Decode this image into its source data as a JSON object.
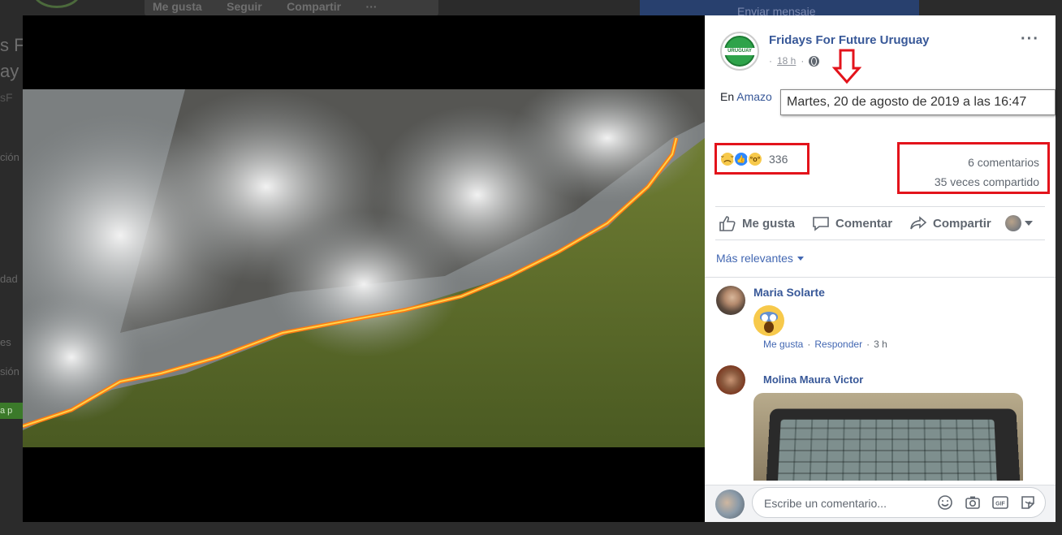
{
  "background": {
    "topbar": [
      "Me gusta",
      "Seguir",
      "Compartir",
      "···"
    ],
    "message_button": "Enviar mensaje",
    "side_title_lines": [
      "s F",
      "ay",
      "sF"
    ],
    "side_labels": [
      "ción",
      "dad",
      "es",
      "sión"
    ],
    "green_tag": "a p"
  },
  "post": {
    "page_name": "Fridays For Future Uruguay",
    "avatar_text": "URUGUAY",
    "time": "18 h",
    "separator": "·",
    "more": "···",
    "text_prefix": "En ",
    "text_link": "Amazo",
    "tooltip": "Martes, 20 de agosto de 2019 a las 16:47",
    "reactions": {
      "count": "336",
      "emojis": [
        "sad-emoji",
        "like-emoji",
        "wow-emoji"
      ],
      "faces": [
        "˘︵˘",
        "👍",
        "°o°"
      ]
    },
    "comments_count": "6 comentarios",
    "shares_count": "35 veces compartido",
    "actions": [
      "Me gusta",
      "Comentar",
      "Compartir"
    ],
    "sort_label": "Más relevantes"
  },
  "comments": [
    {
      "name": "Maria Solarte",
      "actions": [
        "Me gusta",
        "·",
        "Responder",
        "·",
        "3 h"
      ]
    },
    {
      "name": "Molina Maura Victor"
    }
  ],
  "composer": {
    "placeholder": "Escribe un comentario...",
    "icons": [
      "emoji-icon",
      "camera-icon",
      "gif-icon",
      "sticker-icon"
    ],
    "gif_label": "GIF"
  },
  "colors": {
    "highlight": "#e3131b",
    "link": "#385898",
    "accent": "#4267b2"
  }
}
